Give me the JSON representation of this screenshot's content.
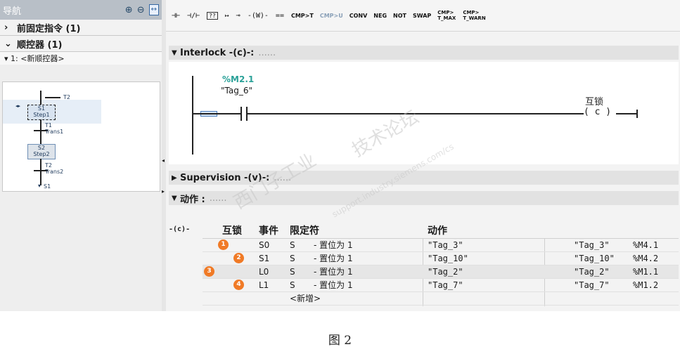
{
  "nav": {
    "title": "导航",
    "zoom_in_icon": "zoom-in-icon",
    "zoom_out_icon": "zoom-out-icon",
    "fit_icon": "fit-view-icon",
    "rows": [
      {
        "caret": "›",
        "label": "前固定指令 (1)"
      },
      {
        "caret": "⌄",
        "label": "顺控器 (1)"
      }
    ],
    "sequencer": "▾ 1: <新顺控器>",
    "mini": {
      "t2_top": "T2",
      "step1_id": "S1",
      "step1_name": "Step1",
      "t1": "T1",
      "t1_name": "Trans1",
      "step2_id": "S2",
      "step2_name": "Step2",
      "t2": "T2",
      "t2_name": "Trans2",
      "jump": "S1"
    }
  },
  "toolbar": {
    "buttons": [
      {
        "label": "⊣⊢",
        "style": "sym"
      },
      {
        "label": "⊣/⊢",
        "style": "sym"
      },
      {
        "label": "??",
        "style": "boxed"
      },
      {
        "label": "↦",
        "style": "sym"
      },
      {
        "label": "⊸",
        "style": "sym"
      },
      {
        "label": "-(W)-",
        "style": "sym"
      },
      {
        "label": "==",
        "style": "sym"
      },
      {
        "label": "CMP>T",
        "style": "txt"
      },
      {
        "label": "CMP>U",
        "style": "txt dim"
      },
      {
        "label": "CONV",
        "style": "txt"
      },
      {
        "label": "NEG",
        "style": "txt"
      },
      {
        "label": "NOT",
        "style": "txt"
      },
      {
        "label": "SWAP",
        "style": "txt"
      }
    ],
    "stacked": [
      {
        "l1": "CMP>",
        "l2": "T_MAX"
      },
      {
        "l1": "CMP>",
        "l2": "T_WARN"
      }
    ]
  },
  "interlock": {
    "label": "Interlock -(c)-:",
    "comment": "......"
  },
  "network": {
    "operand": "%M2.1",
    "tag": "\"Tag_6\"",
    "coil_label": "互锁",
    "coil": "( c )"
  },
  "supervision": {
    "label": "Supervision -(v)-:",
    "comment": "......"
  },
  "actions": {
    "label": "动作 :",
    "comment": "......"
  },
  "table": {
    "c_marker": "-(c)-",
    "headers": {
      "interlock": "互锁",
      "event": "事件",
      "qualifier": "限定符",
      "action": "动作"
    },
    "rows": [
      {
        "badge": "1",
        "event": "S0",
        "q": "S",
        "qdesc": "- 置位为 1",
        "action": "\"Tag_3\"",
        "rtag": "\"Tag_3\"",
        "raddr": "%M4.1"
      },
      {
        "badge": "2",
        "event": "S1",
        "q": "S",
        "qdesc": "- 置位为 1",
        "action": "\"Tag_10\"",
        "rtag": "\"Tag_10\"",
        "raddr": "%M4.2"
      },
      {
        "badge": "3",
        "event": "L0",
        "q": "S",
        "qdesc": "- 置位为 1",
        "action": "\"Tag_2\"",
        "rtag": "\"Tag_2\"",
        "raddr": "%M1.1"
      },
      {
        "badge": "4",
        "event": "L1",
        "q": "S",
        "qdesc": "- 置位为 1",
        "action": "\"Tag_7\"",
        "rtag": "\"Tag_7\"",
        "raddr": "%M1.2"
      }
    ],
    "new_row": "<新增>"
  },
  "watermark": {
    "line1": "西门子工业",
    "line2": "技术论坛",
    "line3": "support.industry.siemens.com/cs"
  },
  "caption": "图 2",
  "colors": {
    "badge": "#f07a26",
    "operand": "#2aa198",
    "section": "#e2e2e2"
  }
}
